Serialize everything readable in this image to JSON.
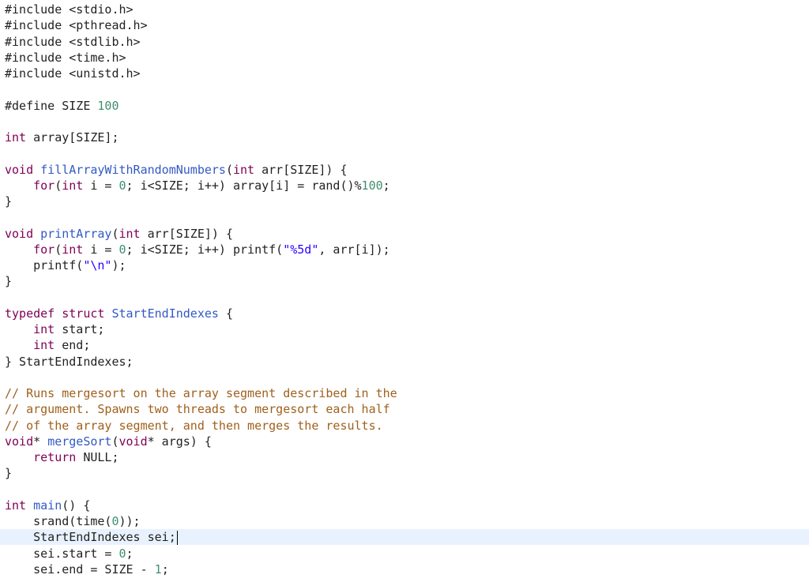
{
  "editor": {
    "colors": {
      "background": "#ffffff",
      "text": "#222222",
      "keyword": "#7f0055",
      "type": "#2a3f8f",
      "function": "#3359c4",
      "string": "#2a00ff",
      "number": "#3f8f6f",
      "comment": "#a0601c",
      "current_line": "#e8f2fe"
    },
    "current_line_index": 33,
    "lines": [
      [
        {
          "t": "#include <stdio.h>",
          "c": "text"
        }
      ],
      [
        {
          "t": "#include <pthread.h>",
          "c": "text"
        }
      ],
      [
        {
          "t": "#include <stdlib.h>",
          "c": "text"
        }
      ],
      [
        {
          "t": "#include <time.h>",
          "c": "text"
        }
      ],
      [
        {
          "t": "#include <unistd.h>",
          "c": "text"
        }
      ],
      [],
      [
        {
          "t": "#define SIZE ",
          "c": "text"
        },
        {
          "t": "100",
          "c": "number"
        }
      ],
      [],
      [
        {
          "t": "int",
          "c": "keyword"
        },
        {
          "t": " array[SIZE];",
          "c": "text"
        }
      ],
      [],
      [
        {
          "t": "void",
          "c": "keyword"
        },
        {
          "t": " ",
          "c": "text"
        },
        {
          "t": "fillArrayWithRandomNumbers",
          "c": "function"
        },
        {
          "t": "(",
          "c": "text"
        },
        {
          "t": "int",
          "c": "keyword"
        },
        {
          "t": " arr[SIZE]) {",
          "c": "text"
        }
      ],
      [
        {
          "t": "    ",
          "c": "text"
        },
        {
          "t": "for",
          "c": "keyword"
        },
        {
          "t": "(",
          "c": "text"
        },
        {
          "t": "int",
          "c": "keyword"
        },
        {
          "t": " i = ",
          "c": "text"
        },
        {
          "t": "0",
          "c": "number"
        },
        {
          "t": "; i<SIZE; i++) array[i] = rand()%",
          "c": "text"
        },
        {
          "t": "100",
          "c": "number"
        },
        {
          "t": ";",
          "c": "text"
        }
      ],
      [
        {
          "t": "}",
          "c": "text"
        }
      ],
      [],
      [
        {
          "t": "void",
          "c": "keyword"
        },
        {
          "t": " ",
          "c": "text"
        },
        {
          "t": "printArray",
          "c": "function"
        },
        {
          "t": "(",
          "c": "text"
        },
        {
          "t": "int",
          "c": "keyword"
        },
        {
          "t": " arr[SIZE]) {",
          "c": "text"
        }
      ],
      [
        {
          "t": "    ",
          "c": "text"
        },
        {
          "t": "for",
          "c": "keyword"
        },
        {
          "t": "(",
          "c": "text"
        },
        {
          "t": "int",
          "c": "keyword"
        },
        {
          "t": " i = ",
          "c": "text"
        },
        {
          "t": "0",
          "c": "number"
        },
        {
          "t": "; i<SIZE; i++) printf(",
          "c": "text"
        },
        {
          "t": "\"%5d\"",
          "c": "string"
        },
        {
          "t": ", arr[i]);",
          "c": "text"
        }
      ],
      [
        {
          "t": "    printf(",
          "c": "text"
        },
        {
          "t": "\"\\n\"",
          "c": "string"
        },
        {
          "t": ");",
          "c": "text"
        }
      ],
      [
        {
          "t": "}",
          "c": "text"
        }
      ],
      [],
      [
        {
          "t": "typedef struct",
          "c": "keyword"
        },
        {
          "t": " ",
          "c": "text"
        },
        {
          "t": "StartEndIndexes",
          "c": "function"
        },
        {
          "t": " {",
          "c": "text"
        }
      ],
      [
        {
          "t": "    ",
          "c": "text"
        },
        {
          "t": "int",
          "c": "keyword"
        },
        {
          "t": " start;",
          "c": "text"
        }
      ],
      [
        {
          "t": "    ",
          "c": "text"
        },
        {
          "t": "int",
          "c": "keyword"
        },
        {
          "t": " end;",
          "c": "text"
        }
      ],
      [
        {
          "t": "} StartEndIndexes;",
          "c": "text"
        }
      ],
      [],
      [
        {
          "t": "// Runs mergesort on the array segment described in the",
          "c": "comment"
        }
      ],
      [
        {
          "t": "// argument. Spawns two threads to mergesort each half",
          "c": "comment"
        }
      ],
      [
        {
          "t": "// of the array segment, and then merges the results.",
          "c": "comment"
        }
      ],
      [
        {
          "t": "void",
          "c": "keyword"
        },
        {
          "t": "* ",
          "c": "text"
        },
        {
          "t": "mergeSort",
          "c": "function"
        },
        {
          "t": "(",
          "c": "text"
        },
        {
          "t": "void",
          "c": "keyword"
        },
        {
          "t": "* args) {",
          "c": "text"
        }
      ],
      [
        {
          "t": "    ",
          "c": "text"
        },
        {
          "t": "return",
          "c": "keyword"
        },
        {
          "t": " NULL;",
          "c": "text"
        }
      ],
      [
        {
          "t": "}",
          "c": "text"
        }
      ],
      [],
      [
        {
          "t": "int",
          "c": "keyword"
        },
        {
          "t": " ",
          "c": "text"
        },
        {
          "t": "main",
          "c": "function"
        },
        {
          "t": "() {",
          "c": "text"
        }
      ],
      [
        {
          "t": "    srand(time(",
          "c": "text"
        },
        {
          "t": "0",
          "c": "number"
        },
        {
          "t": "));",
          "c": "text"
        }
      ],
      [
        {
          "t": "    StartEndIndexes sei;",
          "c": "text"
        }
      ],
      [
        {
          "t": "    sei.start = ",
          "c": "text"
        },
        {
          "t": "0",
          "c": "number"
        },
        {
          "t": ";",
          "c": "text"
        }
      ],
      [
        {
          "t": "    sei.end = SIZE - ",
          "c": "text"
        },
        {
          "t": "1",
          "c": "number"
        },
        {
          "t": ";",
          "c": "text"
        }
      ]
    ]
  }
}
